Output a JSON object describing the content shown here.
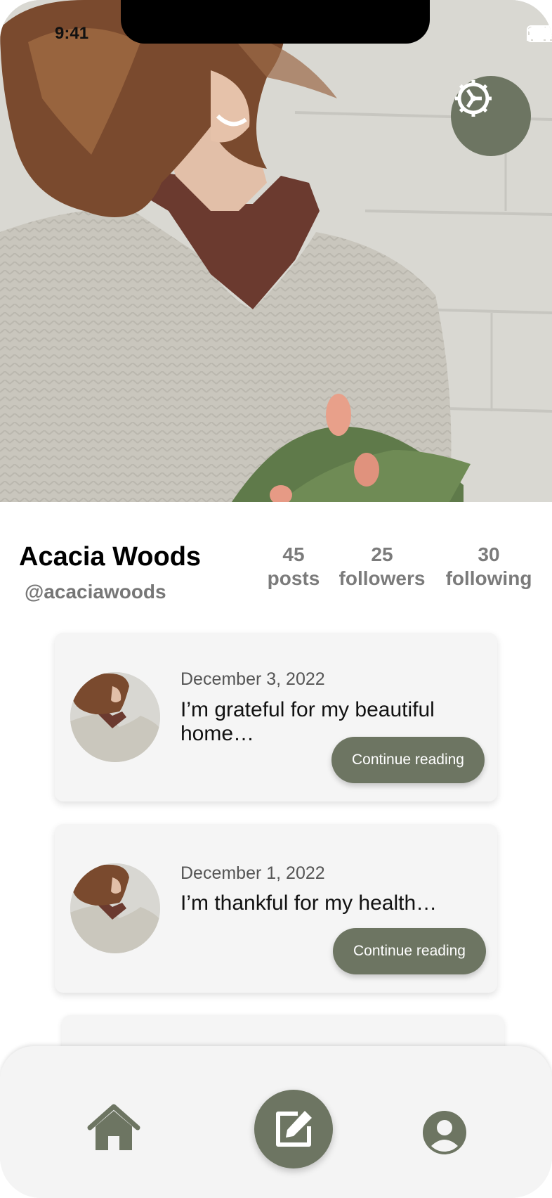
{
  "status_bar": {
    "time": "9:41"
  },
  "profile": {
    "name": "Acacia Woods",
    "handle": "@acaciawoods",
    "stats": [
      {
        "value": "45",
        "label": "posts"
      },
      {
        "value": "25",
        "label": "followers"
      },
      {
        "value": "30",
        "label": "following"
      }
    ]
  },
  "posts": [
    {
      "date": "December 3, 2022",
      "excerpt": "I’m grateful for my beautiful home…",
      "button": "Continue reading"
    },
    {
      "date": "December 1, 2022",
      "excerpt": "I’m thankful for my health…",
      "button": "Continue reading"
    }
  ],
  "icons": {
    "settings": "gear-icon",
    "home": "home-icon",
    "compose": "compose-icon",
    "profile": "profile-icon"
  },
  "colors": {
    "accent": "#6d7562",
    "card_bg": "#f5f5f5",
    "nav_bg": "#f4f4f4"
  }
}
